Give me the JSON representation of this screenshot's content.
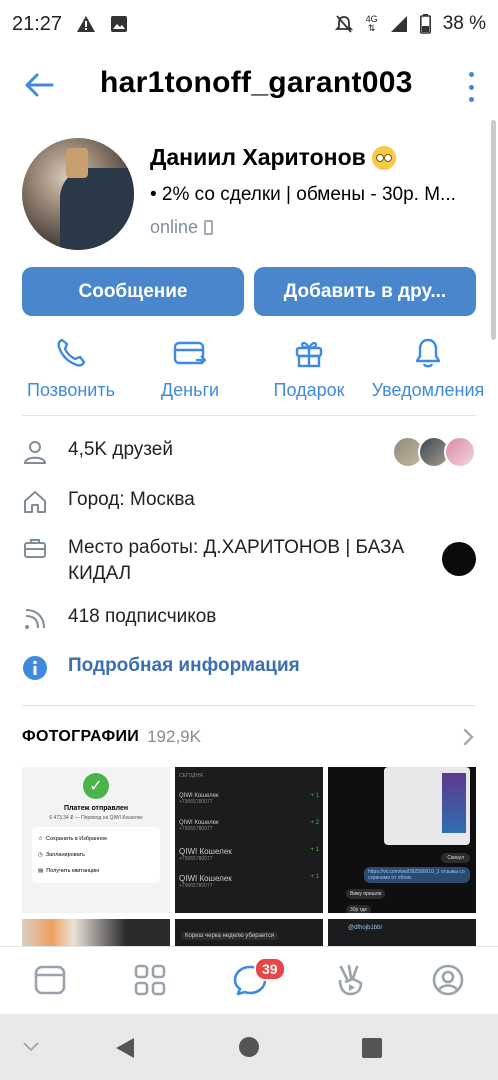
{
  "status_bar": {
    "time": "21:27",
    "network": "4G",
    "battery": "38 %",
    "icons": [
      "warning-icon",
      "image-icon",
      "notifications-off-icon",
      "signal-icon",
      "battery-icon"
    ]
  },
  "header": {
    "title": "har1tonoff_garant003"
  },
  "profile": {
    "name": "Даниил Харитонов",
    "status": "• 2% со сделки | обмены - 30р. М...",
    "online": "online"
  },
  "buttons": {
    "message": "Сообщение",
    "add_friend": "Добавить в дру..."
  },
  "actions": [
    {
      "label": "Позвонить",
      "icon": "phone-icon"
    },
    {
      "label": "Деньги",
      "icon": "money-card-icon"
    },
    {
      "label": "Подарок",
      "icon": "gift-icon"
    },
    {
      "label": "Уведомления",
      "icon": "bell-icon"
    }
  ],
  "info": {
    "friends": "4,5K друзей",
    "city": "Город: Москва",
    "work": "Место работы: Д.ХАРИТОНОВ | БАЗА КИДАЛ",
    "followers": "418 подписчиков",
    "details": "Подробная информация"
  },
  "photos": {
    "title": "ФОТОГРАФИИ",
    "count": "192,9K",
    "tile1": {
      "heading": "Платеж отправлен",
      "sub": "6 473,34 ₽ — Перевод на QIWI Кошелек",
      "items": [
        "Сохранить в Избранное",
        "Запланировать",
        "Получить квитанцию"
      ]
    },
    "tile2": {
      "header": "СЕГОДНЯ",
      "rows": [
        {
          "name": "QIWI Кошелек",
          "num": "+79065780077",
          "amt": "+ 1"
        },
        {
          "name": "QIWI Кошелек",
          "num": "+79065780077",
          "amt": "+ 2"
        },
        {
          "name": "QIWI Кошелек",
          "num": "+79065780077",
          "amt": "+ 1"
        },
        {
          "name": "QIWI Кошелек",
          "num": "+79065780077",
          "amt": "+ 1"
        }
      ]
    },
    "tile3": {
      "bubble1": "Скинул",
      "link": "https://vk.com/wall392580010_1 отзывы со скринами от обоих",
      "bubble2": "Вижу пришли",
      "bubble3": "30р где"
    },
    "tile5": {
      "text": "Кориш черка неделю убирается"
    },
    "tile6": {
      "text": "@dfhojb1bbl"
    }
  },
  "tabbar": {
    "badge": "39",
    "tabs": [
      "home-icon",
      "services-icon",
      "messages-icon",
      "clips-icon",
      "profile-icon"
    ]
  }
}
